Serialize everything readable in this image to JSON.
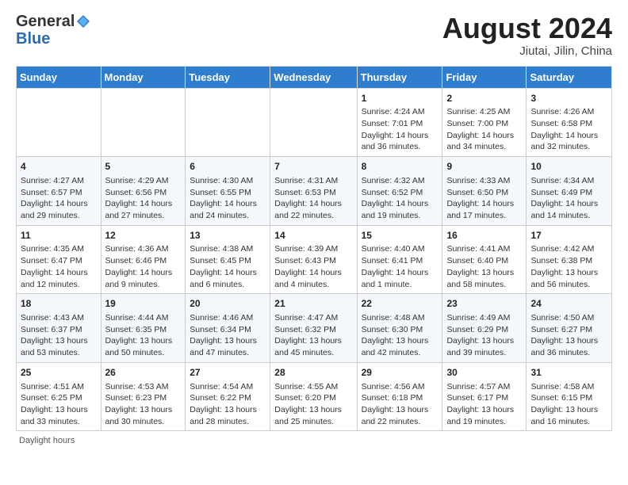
{
  "header": {
    "logo_general": "General",
    "logo_blue": "Blue",
    "month_year": "August 2024",
    "location": "Jiutai, Jilin, China"
  },
  "days_of_week": [
    "Sunday",
    "Monday",
    "Tuesday",
    "Wednesday",
    "Thursday",
    "Friday",
    "Saturday"
  ],
  "footer_label": "Daylight hours",
  "weeks": [
    [
      {
        "day": "",
        "info": ""
      },
      {
        "day": "",
        "info": ""
      },
      {
        "day": "",
        "info": ""
      },
      {
        "day": "",
        "info": ""
      },
      {
        "day": "1",
        "info": "Sunrise: 4:24 AM\nSunset: 7:01 PM\nDaylight: 14 hours\nand 36 minutes."
      },
      {
        "day": "2",
        "info": "Sunrise: 4:25 AM\nSunset: 7:00 PM\nDaylight: 14 hours\nand 34 minutes."
      },
      {
        "day": "3",
        "info": "Sunrise: 4:26 AM\nSunset: 6:58 PM\nDaylight: 14 hours\nand 32 minutes."
      }
    ],
    [
      {
        "day": "4",
        "info": "Sunrise: 4:27 AM\nSunset: 6:57 PM\nDaylight: 14 hours\nand 29 minutes."
      },
      {
        "day": "5",
        "info": "Sunrise: 4:29 AM\nSunset: 6:56 PM\nDaylight: 14 hours\nand 27 minutes."
      },
      {
        "day": "6",
        "info": "Sunrise: 4:30 AM\nSunset: 6:55 PM\nDaylight: 14 hours\nand 24 minutes."
      },
      {
        "day": "7",
        "info": "Sunrise: 4:31 AM\nSunset: 6:53 PM\nDaylight: 14 hours\nand 22 minutes."
      },
      {
        "day": "8",
        "info": "Sunrise: 4:32 AM\nSunset: 6:52 PM\nDaylight: 14 hours\nand 19 minutes."
      },
      {
        "day": "9",
        "info": "Sunrise: 4:33 AM\nSunset: 6:50 PM\nDaylight: 14 hours\nand 17 minutes."
      },
      {
        "day": "10",
        "info": "Sunrise: 4:34 AM\nSunset: 6:49 PM\nDaylight: 14 hours\nand 14 minutes."
      }
    ],
    [
      {
        "day": "11",
        "info": "Sunrise: 4:35 AM\nSunset: 6:47 PM\nDaylight: 14 hours\nand 12 minutes."
      },
      {
        "day": "12",
        "info": "Sunrise: 4:36 AM\nSunset: 6:46 PM\nDaylight: 14 hours\nand 9 minutes."
      },
      {
        "day": "13",
        "info": "Sunrise: 4:38 AM\nSunset: 6:45 PM\nDaylight: 14 hours\nand 6 minutes."
      },
      {
        "day": "14",
        "info": "Sunrise: 4:39 AM\nSunset: 6:43 PM\nDaylight: 14 hours\nand 4 minutes."
      },
      {
        "day": "15",
        "info": "Sunrise: 4:40 AM\nSunset: 6:41 PM\nDaylight: 14 hours\nand 1 minute."
      },
      {
        "day": "16",
        "info": "Sunrise: 4:41 AM\nSunset: 6:40 PM\nDaylight: 13 hours\nand 58 minutes."
      },
      {
        "day": "17",
        "info": "Sunrise: 4:42 AM\nSunset: 6:38 PM\nDaylight: 13 hours\nand 56 minutes."
      }
    ],
    [
      {
        "day": "18",
        "info": "Sunrise: 4:43 AM\nSunset: 6:37 PM\nDaylight: 13 hours\nand 53 minutes."
      },
      {
        "day": "19",
        "info": "Sunrise: 4:44 AM\nSunset: 6:35 PM\nDaylight: 13 hours\nand 50 minutes."
      },
      {
        "day": "20",
        "info": "Sunrise: 4:46 AM\nSunset: 6:34 PM\nDaylight: 13 hours\nand 47 minutes."
      },
      {
        "day": "21",
        "info": "Sunrise: 4:47 AM\nSunset: 6:32 PM\nDaylight: 13 hours\nand 45 minutes."
      },
      {
        "day": "22",
        "info": "Sunrise: 4:48 AM\nSunset: 6:30 PM\nDaylight: 13 hours\nand 42 minutes."
      },
      {
        "day": "23",
        "info": "Sunrise: 4:49 AM\nSunset: 6:29 PM\nDaylight: 13 hours\nand 39 minutes."
      },
      {
        "day": "24",
        "info": "Sunrise: 4:50 AM\nSunset: 6:27 PM\nDaylight: 13 hours\nand 36 minutes."
      }
    ],
    [
      {
        "day": "25",
        "info": "Sunrise: 4:51 AM\nSunset: 6:25 PM\nDaylight: 13 hours\nand 33 minutes."
      },
      {
        "day": "26",
        "info": "Sunrise: 4:53 AM\nSunset: 6:23 PM\nDaylight: 13 hours\nand 30 minutes."
      },
      {
        "day": "27",
        "info": "Sunrise: 4:54 AM\nSunset: 6:22 PM\nDaylight: 13 hours\nand 28 minutes."
      },
      {
        "day": "28",
        "info": "Sunrise: 4:55 AM\nSunset: 6:20 PM\nDaylight: 13 hours\nand 25 minutes."
      },
      {
        "day": "29",
        "info": "Sunrise: 4:56 AM\nSunset: 6:18 PM\nDaylight: 13 hours\nand 22 minutes."
      },
      {
        "day": "30",
        "info": "Sunrise: 4:57 AM\nSunset: 6:17 PM\nDaylight: 13 hours\nand 19 minutes."
      },
      {
        "day": "31",
        "info": "Sunrise: 4:58 AM\nSunset: 6:15 PM\nDaylight: 13 hours\nand 16 minutes."
      }
    ]
  ]
}
